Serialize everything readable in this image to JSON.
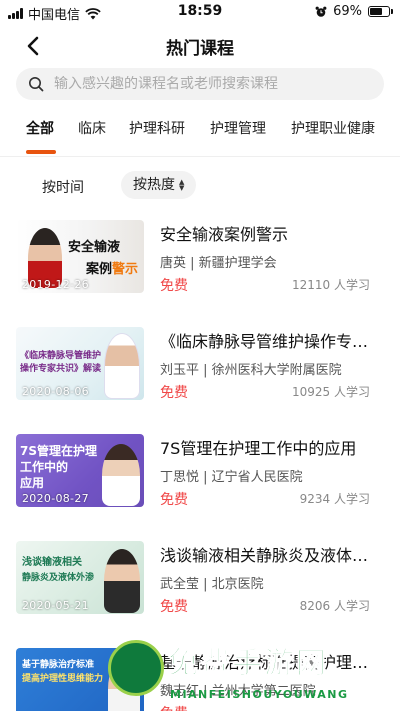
{
  "status_bar": {
    "carrier": "中国电信",
    "time": "18:59",
    "battery": "69%",
    "battery_level": 0.69
  },
  "nav": {
    "title": "热门课程"
  },
  "search": {
    "placeholder": "输入感兴趣的课程名或老师搜索课程"
  },
  "tabs": [
    {
      "label": "全部",
      "active": true
    },
    {
      "label": "临床",
      "active": false
    },
    {
      "label": "护理科研",
      "active": false
    },
    {
      "label": "护理管理",
      "active": false
    },
    {
      "label": "护理职业健康",
      "active": false
    }
  ],
  "sort": {
    "by_time": "按时间",
    "by_hot": "按热度"
  },
  "courses": [
    {
      "title": "安全输液案例警示",
      "teacher": "唐英",
      "org": "新疆护理学会",
      "price": "免费",
      "learners": "12110 人学习",
      "thumb_date": "2019-12-26",
      "thumb_lines": [
        "安全输液",
        "案例警示"
      ]
    },
    {
      "title": "《临床静脉导管维护操作专家共识》解读",
      "teacher": "刘玉平",
      "org": "徐州医科大学附属医院",
      "price": "免费",
      "learners": "10925 人学习",
      "thumb_date": "2020-08-06",
      "thumb_lines": [
        "《临床静脉导管维护",
        "操作专家共识》解读"
      ]
    },
    {
      "title": "7S管理在护理工作中的应用",
      "teacher": "丁思悦",
      "org": "辽宁省人民医院",
      "price": "免费",
      "learners": "9234 人学习",
      "thumb_date": "2020-08-27",
      "thumb_lines": [
        "7S管理在护理",
        "工作中的",
        "应用"
      ]
    },
    {
      "title": "浅谈输液相关静脉炎及液体外渗",
      "teacher": "武全莹",
      "org": "北京医院",
      "price": "免费",
      "learners": "8206 人学习",
      "thumb_date": "2020-05-21",
      "thumb_lines": [
        "浅谈输液相关",
        "静脉炎及液体外渗"
      ]
    },
    {
      "title": "基于静脉治疗标准提高护理性思维能力",
      "teacher": "魏志红",
      "org": "兰州大学第二医院",
      "price": "免费",
      "learners": "",
      "thumb_date": "",
      "thumb_lines": [
        "基于静脉治疗标准",
        "提高护理性思维能力"
      ]
    }
  ],
  "watermark": {
    "text": "免费手游网",
    "sub": "MIANFEISHOUYOUWANG"
  },
  "colors": {
    "accent": "#e8540f",
    "price": "#f04848",
    "search_bg": "#f2f2f2"
  }
}
